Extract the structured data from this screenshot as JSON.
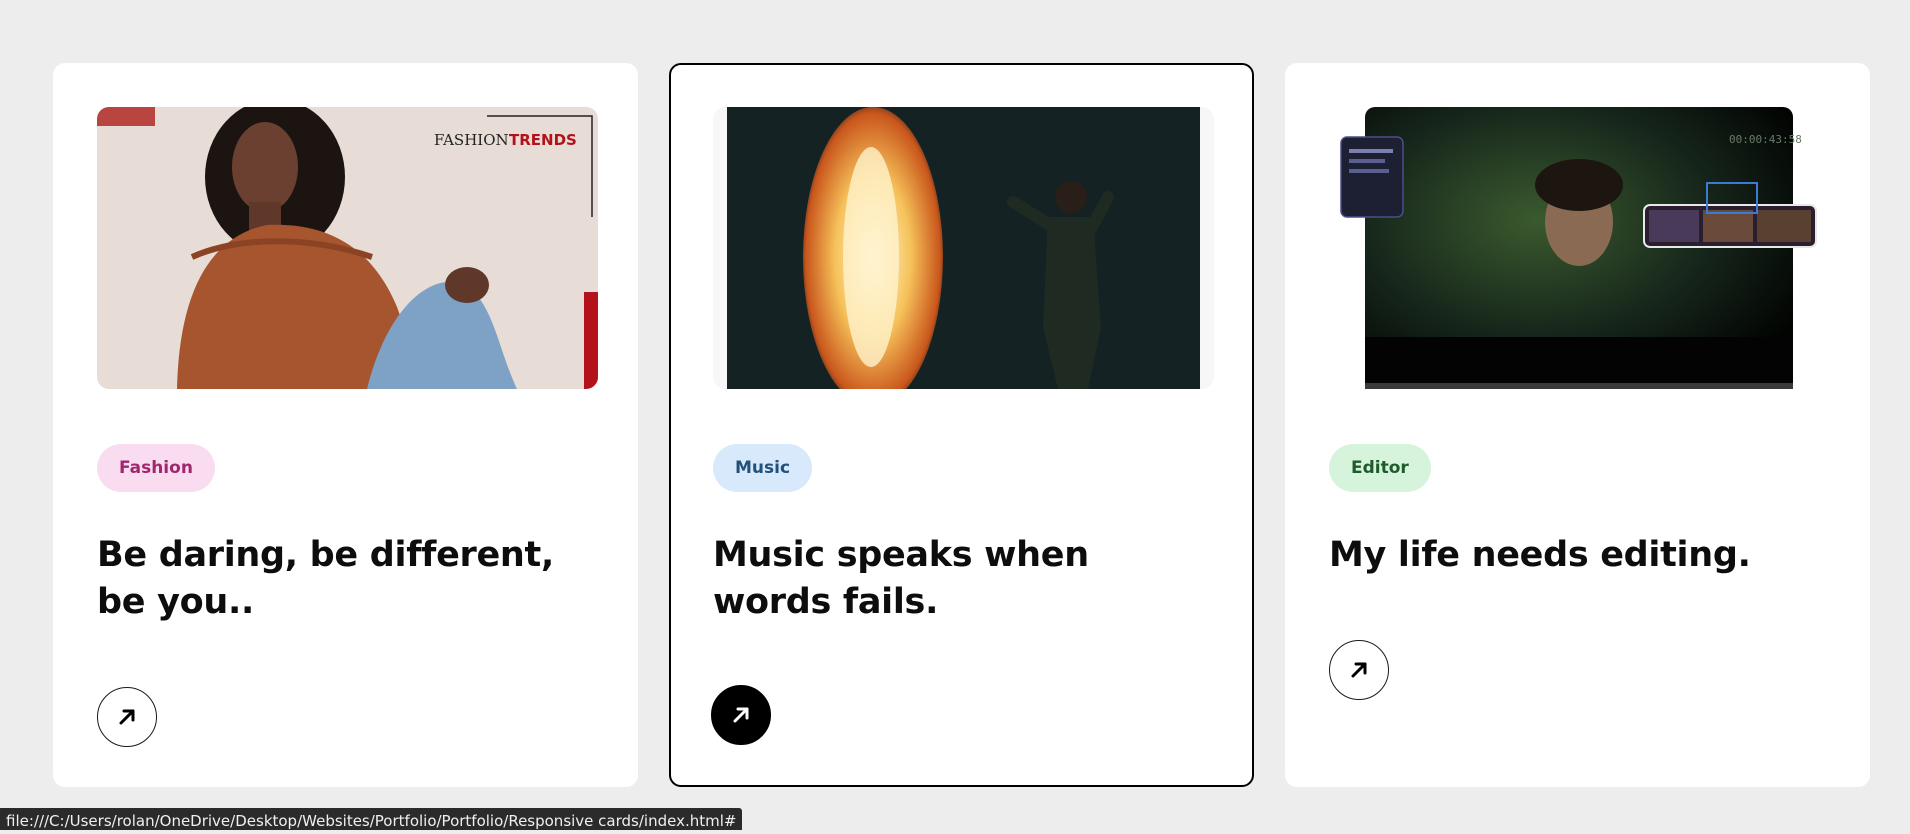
{
  "cards": [
    {
      "tag": "Fashion",
      "tag_bg": "#f9dcef",
      "tag_color": "#a1266d",
      "title": "Be daring, be different, be you..",
      "image_text_1": "FASHION",
      "image_text_2": "TRENDS"
    },
    {
      "tag": "Music",
      "tag_bg": "#d7e9fb",
      "tag_color": "#22527c",
      "title": "Music speaks when words fails."
    },
    {
      "tag": "Editor",
      "tag_bg": "#d6f4dc",
      "tag_color": "#1f5a2b",
      "title": "My life needs editing.",
      "image_text_timecode": "00:00:43:58"
    }
  ],
  "status_bar": {
    "url": "file:///C:/Users/rolan/OneDrive/Desktop/Websites/Portfolio/Portfolio/Responsive cards/index.html#"
  },
  "icons": {
    "arrow": "arrow-up-right-icon"
  }
}
